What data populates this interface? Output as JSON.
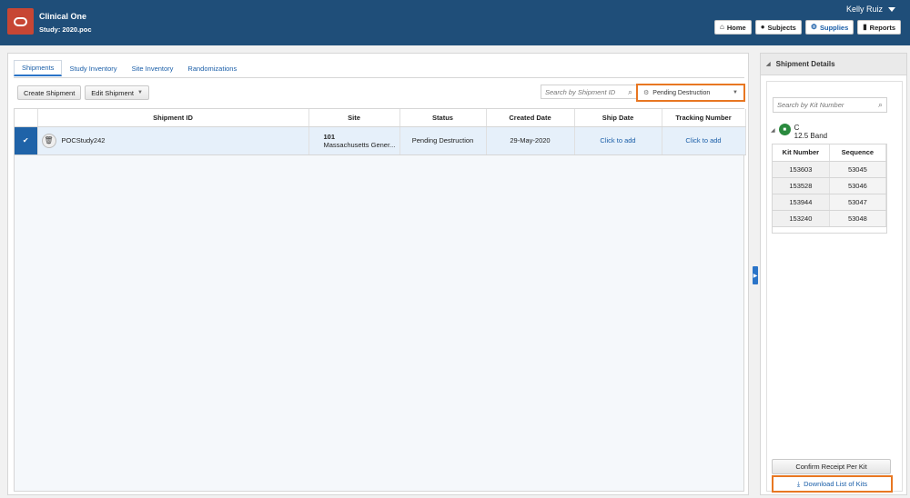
{
  "header": {
    "app_title": "Clinical One",
    "study": "Study: 2020.poc",
    "user": "Kelly Ruiz",
    "nav": [
      {
        "label": "Home",
        "icon": "home-icon"
      },
      {
        "label": "Subjects",
        "icon": "person-icon"
      },
      {
        "label": "Supplies",
        "icon": "supplies-icon"
      },
      {
        "label": "Reports",
        "icon": "bar-chart-icon"
      }
    ]
  },
  "tabs": [
    "Shipments",
    "Study Inventory",
    "Site Inventory",
    "Randomizations"
  ],
  "toolbar": {
    "create": "Create Shipment",
    "edit": "Edit Shipment",
    "search_placeholder": "Search by Shipment ID",
    "filter_value": "Pending Destruction"
  },
  "table": {
    "headers": [
      "Shipment ID",
      "Site",
      "Status",
      "Created Date",
      "Ship Date",
      "Tracking Number"
    ],
    "rows": [
      {
        "shipment_id": "POCStudy242",
        "site_number": "101",
        "site_name": "Massachusetts Gener...",
        "status": "Pending Destruction",
        "created": "29-May-2020",
        "ship_date": "Click to add",
        "tracking": "Click to add"
      }
    ]
  },
  "side": {
    "title": "Shipment Details",
    "search_placeholder": "Search by Kit Number",
    "kit_group": {
      "name": "C",
      "detail": "12.5 Band"
    },
    "kit_headers": [
      "Kit Number",
      "Sequence"
    ],
    "kits": [
      [
        "153603",
        "53045"
      ],
      [
        "153528",
        "53046"
      ],
      [
        "153944",
        "53047"
      ],
      [
        "153240",
        "53048"
      ]
    ],
    "confirm": "Confirm Receipt Per Kit",
    "download": "Download List of Kits"
  },
  "colors": {
    "header_bg": "#1f4e79",
    "logo": "#c74634",
    "highlight": "#e87722",
    "selected": "#1f63a8",
    "link": "#1a5ea8"
  }
}
